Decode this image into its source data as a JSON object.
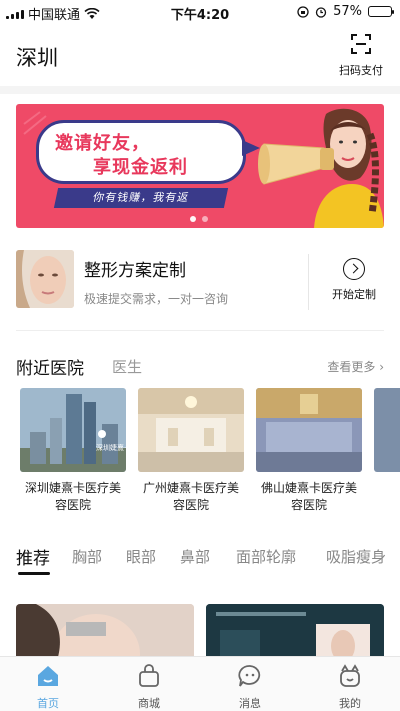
{
  "status_bar": {
    "carrier": "中国联通",
    "time": "下午4:20",
    "battery": "57%",
    "battery_level": 0.57
  },
  "header": {
    "city": "深圳",
    "scan_label": "扫码支付",
    "scan_icon": "scan-icon"
  },
  "banner": {
    "line1": "邀请好友，",
    "line2": "享现金返利",
    "ribbon": "你有钱赚，我有返",
    "dots": 2,
    "active_dot": 1
  },
  "plan": {
    "title": "整形方案定制",
    "subtitle": "极速提交需求，一对一咨询",
    "cta": "开始定制"
  },
  "nearby": {
    "tab_hospital": "附近医院",
    "tab_doctor": "医生",
    "more": "查看更多 ›",
    "hospitals": [
      {
        "name": "深圳婕熹卡医疗美容医院",
        "sign": "深圳婕熹卡"
      },
      {
        "name": "广州婕熹卡医疗美容医院"
      },
      {
        "name": "佛山婕熹卡医疗美容医院"
      }
    ]
  },
  "tabs": [
    "推荐",
    "胸部",
    "眼部",
    "鼻部",
    "面部轮廓",
    "吸脂瘦身"
  ],
  "bottom_nav": [
    {
      "label": "首页",
      "icon": "home-icon",
      "active": true
    },
    {
      "label": "商城",
      "icon": "shopping-bag-icon",
      "active": false
    },
    {
      "label": "消息",
      "icon": "message-icon",
      "active": false
    },
    {
      "label": "我的",
      "icon": "profile-icon",
      "active": false
    }
  ],
  "colors": {
    "banner_bg": "#ef4a67",
    "active_nav": "#5aa7e0"
  }
}
